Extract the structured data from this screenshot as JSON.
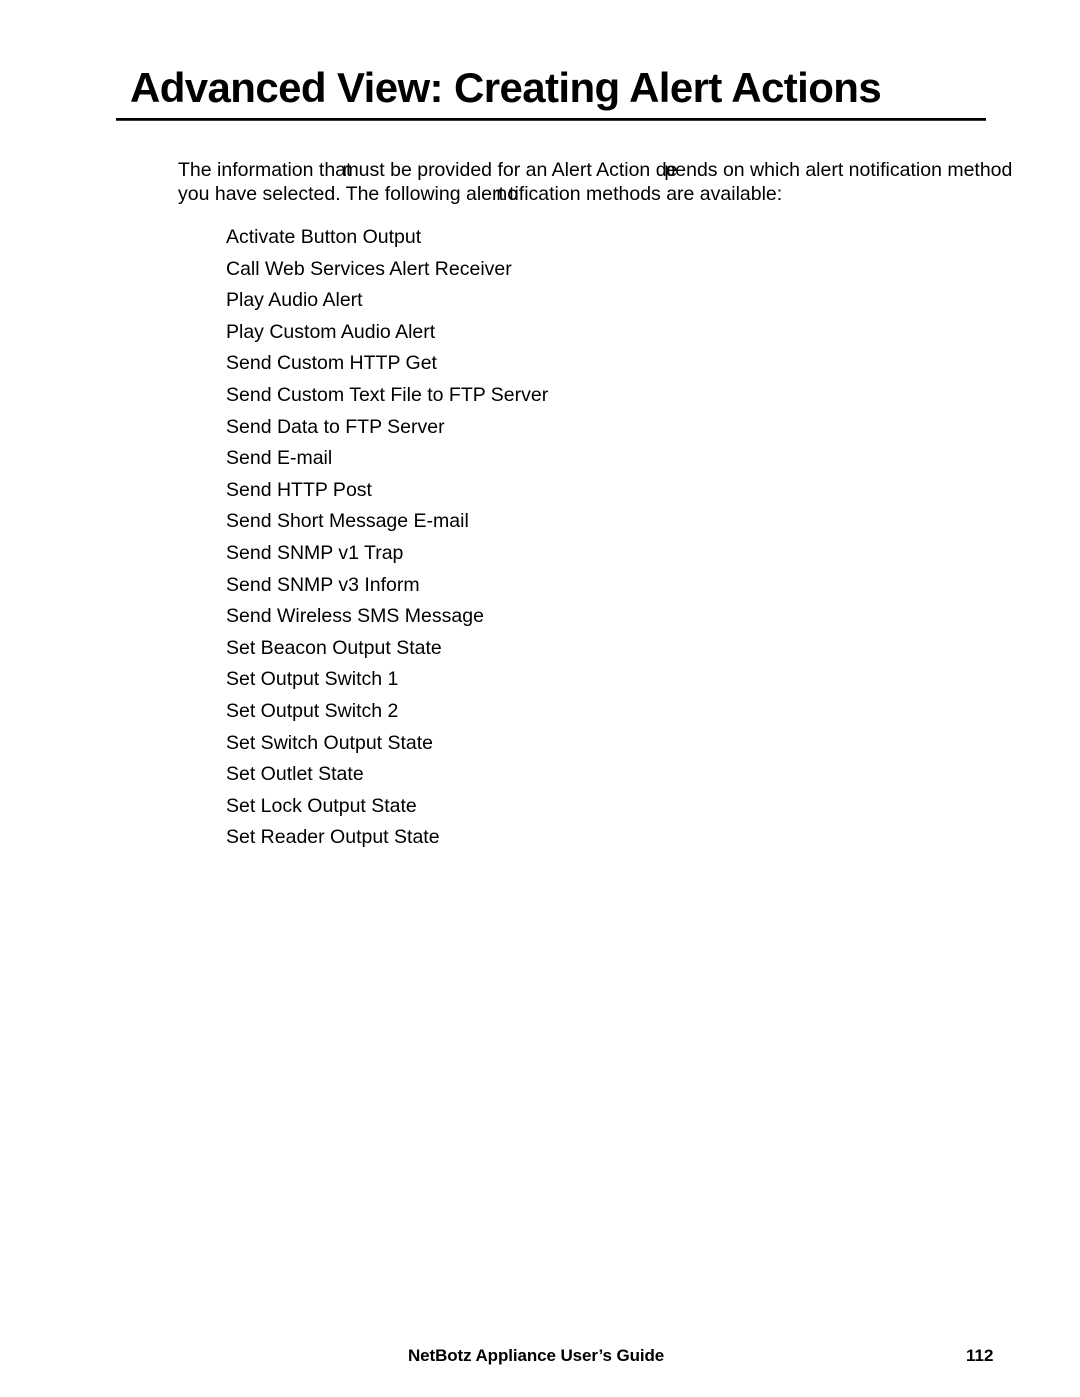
{
  "document": {
    "title": "Advanced View: Creating Alert Actions"
  },
  "intro": {
    "line1_a": "The information that",
    "line1_b": "must be provided for an Alert Action ",
    "line1_c": "de",
    "line1_d": "pends on which alert notification method",
    "line2_a": "you have selected. The following ",
    "line2_b": "alert",
    "line2_c": " no",
    "line2_d": "tification methods are available:"
  },
  "methods": [
    "Activate Button Output",
    "Call Web Services Alert Receiver",
    "Play Audio Alert",
    "Play Custom Audio Alert",
    "Send Custom HTTP Get",
    "Send Custom Text File to FTP Server",
    "Send Data to FTP Server",
    "Send E-mail",
    "Send HTTP Post",
    "Send Short Message E-mail",
    "Send SNMP v1 Trap",
    "Send SNMP v3 Inform",
    "Send Wireless SMS Message",
    "Set Beacon Output State",
    "Set Output Switch 1",
    "Set Output Switch 2",
    "Set Switch Output State",
    "Set Outlet State",
    "Set Lock Output State",
    "Set Reader Output State"
  ],
  "footer": {
    "guide_title": "NetBotz Appliance User’s Guide",
    "page_number": "112"
  }
}
